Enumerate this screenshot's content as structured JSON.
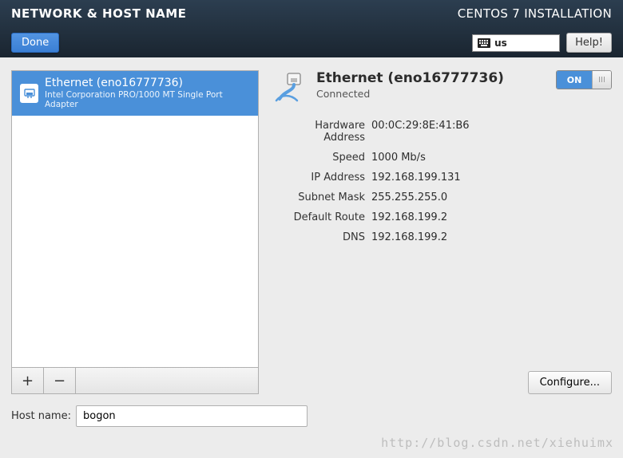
{
  "header": {
    "title": "NETWORK & HOST NAME",
    "installer_title": "CENTOS 7 INSTALLATION",
    "done_label": "Done",
    "help_label": "Help!",
    "keyboard_layout": "us"
  },
  "device_list": {
    "items": [
      {
        "title": "Ethernet (eno16777736)",
        "subtitle": "Intel Corporation PRO/1000 MT Single Port Adapter",
        "selected": true
      }
    ],
    "add_label": "+",
    "remove_label": "−"
  },
  "interface": {
    "title": "Ethernet (eno16777736)",
    "status": "Connected",
    "toggle_on_label": "ON",
    "toggle_handle_glyph": "III",
    "details": {
      "hardware_address": {
        "label": "Hardware Address",
        "value": "00:0C:29:8E:41:B6"
      },
      "speed": {
        "label": "Speed",
        "value": "1000 Mb/s"
      },
      "ip_address": {
        "label": "IP Address",
        "value": "192.168.199.131"
      },
      "subnet_mask": {
        "label": "Subnet Mask",
        "value": "255.255.255.0"
      },
      "default_route": {
        "label": "Default Route",
        "value": "192.168.199.2"
      },
      "dns": {
        "label": "DNS",
        "value": "192.168.199.2"
      }
    },
    "configure_label": "Configure..."
  },
  "hostname": {
    "label": "Host name:",
    "value": "bogon"
  },
  "watermark": "http://blog.csdn.net/xiehuimx"
}
